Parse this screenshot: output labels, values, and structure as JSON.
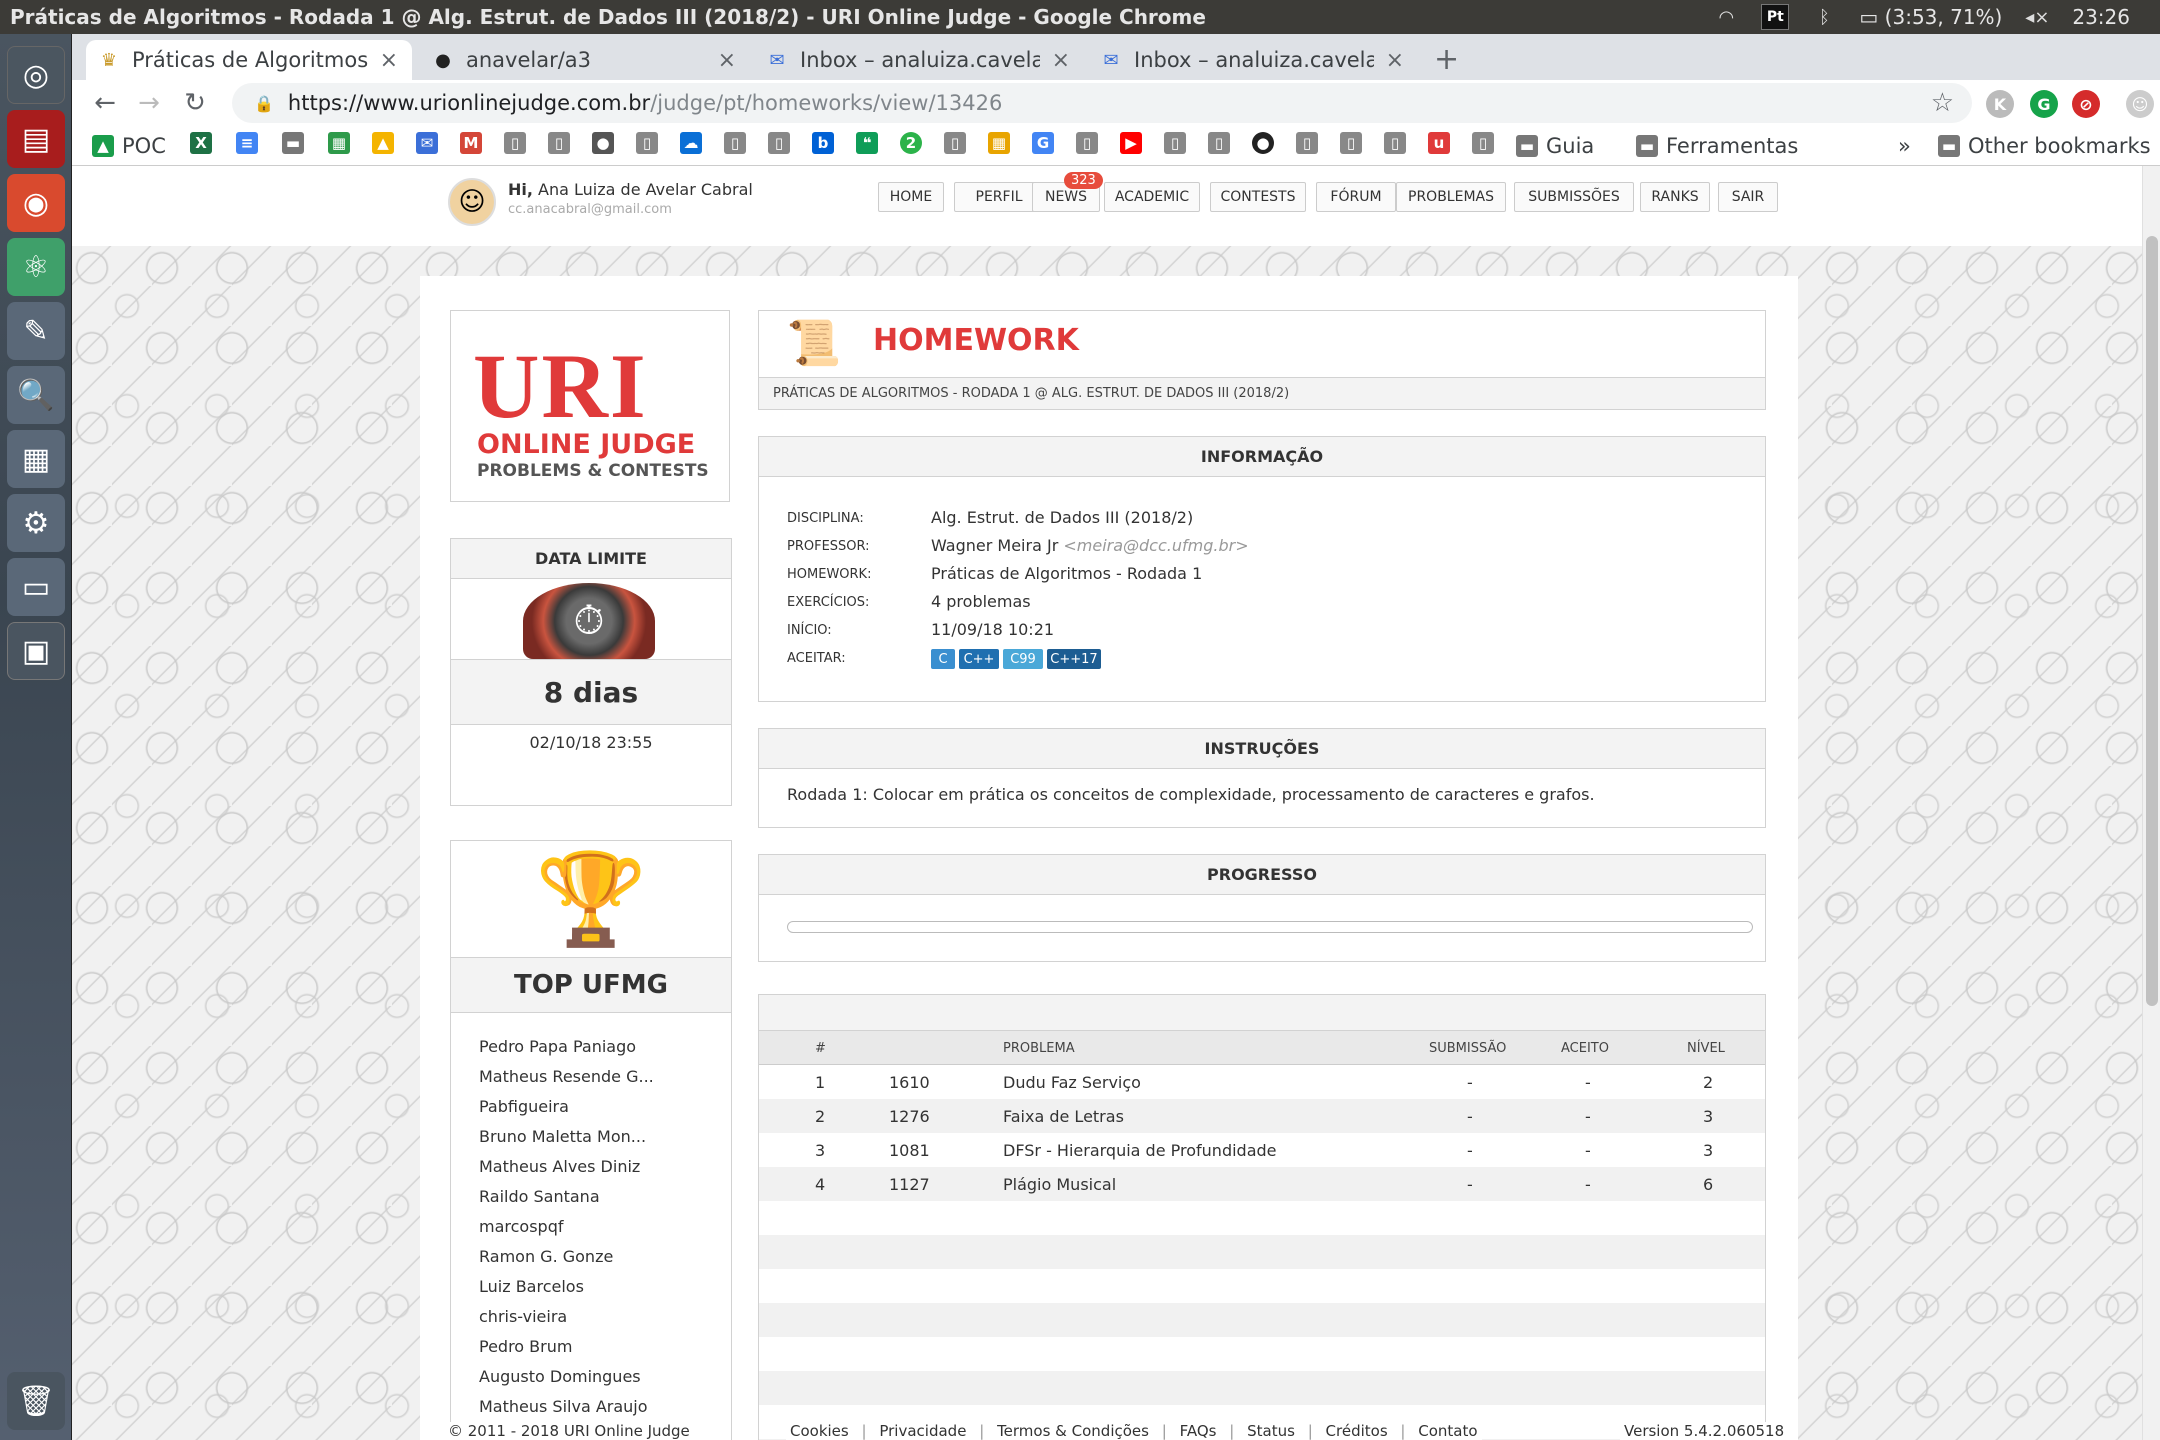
{
  "os": {
    "window_title": "Práticas de Algoritmos - Rodada 1 @ Alg. Estrut. de Dados III (2018/2) - URI Online Judge - Google Chrome",
    "tray_pt": "Pt",
    "battery": "(3:53, 71%)",
    "clock": "23:26"
  },
  "tabs": [
    {
      "label": "Práticas de Algoritmos - R",
      "icon": "trophy-icon"
    },
    {
      "label": "anavelar/a3",
      "icon": "github-icon"
    },
    {
      "label": "Inbox – analuiza.cavelar@",
      "icon": "inbox-icon"
    },
    {
      "label": "Inbox – analuiza.cavelar@",
      "icon": "inbox-icon"
    }
  ],
  "address": {
    "host": "https://www.urionlinejudge.com.br",
    "path": "/judge/pt/homeworks/view/13426"
  },
  "bookmarks": {
    "poc": "POC",
    "guia": "Guia",
    "ferramentas": "Ferramentas",
    "more": "»",
    "other": "Other bookmarks"
  },
  "header": {
    "greeting_prefix": "Hi,",
    "user_name": "Ana Luiza de Avelar Cabral",
    "email": "cc.anacabral@gmail.com",
    "news_badge": "323",
    "menu": [
      "HOME",
      "PERFIL",
      "NEWS",
      "ACADEMIC",
      "CONTESTS",
      "FÓRUM",
      "PROBLEMAS",
      "SUBMISSÕES",
      "RANKS",
      "SAIR"
    ]
  },
  "logo": {
    "uri": "URI",
    "online_judge": "ONLINE JUDGE",
    "problems": "PROBLEMS & CONTESTS"
  },
  "deadline": {
    "title": "DATA LIMITE",
    "days": "8 dias",
    "date": "02/10/18 23:55"
  },
  "top": {
    "title": "TOP UFMG",
    "names": [
      "Pedro Papa Paniago",
      "Matheus Resende G...",
      "Pabfigueira",
      "Bruno Maletta Mon...",
      "Matheus Alves Diniz",
      "Raildo Santana",
      "marcospqf",
      "Ramon G. Gonze",
      "Luiz Barcelos",
      "chris-vieira",
      "Pedro Brum",
      "Augusto Domingues",
      "Matheus Silva Araujo"
    ]
  },
  "homework": {
    "title": "HOMEWORK",
    "subtitle": "PRÁTICAS DE ALGORITMOS - RODADA 1 @ ALG. ESTRUT. DE DADOS III (2018/2)"
  },
  "info": {
    "title": "INFORMAÇÃO",
    "labels": {
      "disciplina": "DISCIPLINA:",
      "professor": "PROFESSOR:",
      "homework": "HOMEWORK:",
      "exercicios": "EXERCÍCIOS:",
      "inicio": "INÍCIO:",
      "aceitar": "ACEITAR:"
    },
    "disciplina": "Alg. Estrut. de Dados III (2018/2)",
    "professor": "Wagner Meira Jr",
    "professor_email": "<meira@dcc.ufmg.br>",
    "homework": "Práticas de Algoritmos - Rodada 1",
    "exercicios": "4 problemas",
    "inicio": "11/09/18 10:21",
    "languages": [
      "C",
      "C++",
      "C99",
      "C++17"
    ],
    "language_colors": [
      "#3a8fd0",
      "#1f6fb0",
      "#4aa8d8",
      "#1d5d92"
    ]
  },
  "instructions": {
    "title": "INSTRUÇÕES",
    "text": "Rodada 1: Colocar em prática os conceitos de complexidade, processamento de caracteres e grafos."
  },
  "progress": {
    "title": "PROGRESSO",
    "value": 0
  },
  "problems": {
    "headers": {
      "num": "#",
      "problem": "PROBLEMA",
      "submission": "SUBMISSÃO",
      "accepted": "ACEITO",
      "level": "NÍVEL"
    },
    "rows": [
      {
        "n": "1",
        "id": "1610",
        "name": "Dudu Faz Serviço",
        "sub": "-",
        "acc": "-",
        "level": "2"
      },
      {
        "n": "2",
        "id": "1276",
        "name": "Faixa de Letras",
        "sub": "-",
        "acc": "-",
        "level": "3"
      },
      {
        "n": "3",
        "id": "1081",
        "name": "DFSr - Hierarquia de Profundidade",
        "sub": "-",
        "acc": "-",
        "level": "3"
      },
      {
        "n": "4",
        "id": "1127",
        "name": "Plágio Musical",
        "sub": "-",
        "acc": "-",
        "level": "6"
      }
    ]
  },
  "footer": {
    "copyright": "© 2011 - 2018 URI Online Judge",
    "links": [
      "Cookies",
      "Privacidade",
      "Termos & Condições",
      "FAQs",
      "Status",
      "Créditos",
      "Contato"
    ],
    "separator": "|",
    "version": "Version 5.4.2.060518"
  }
}
